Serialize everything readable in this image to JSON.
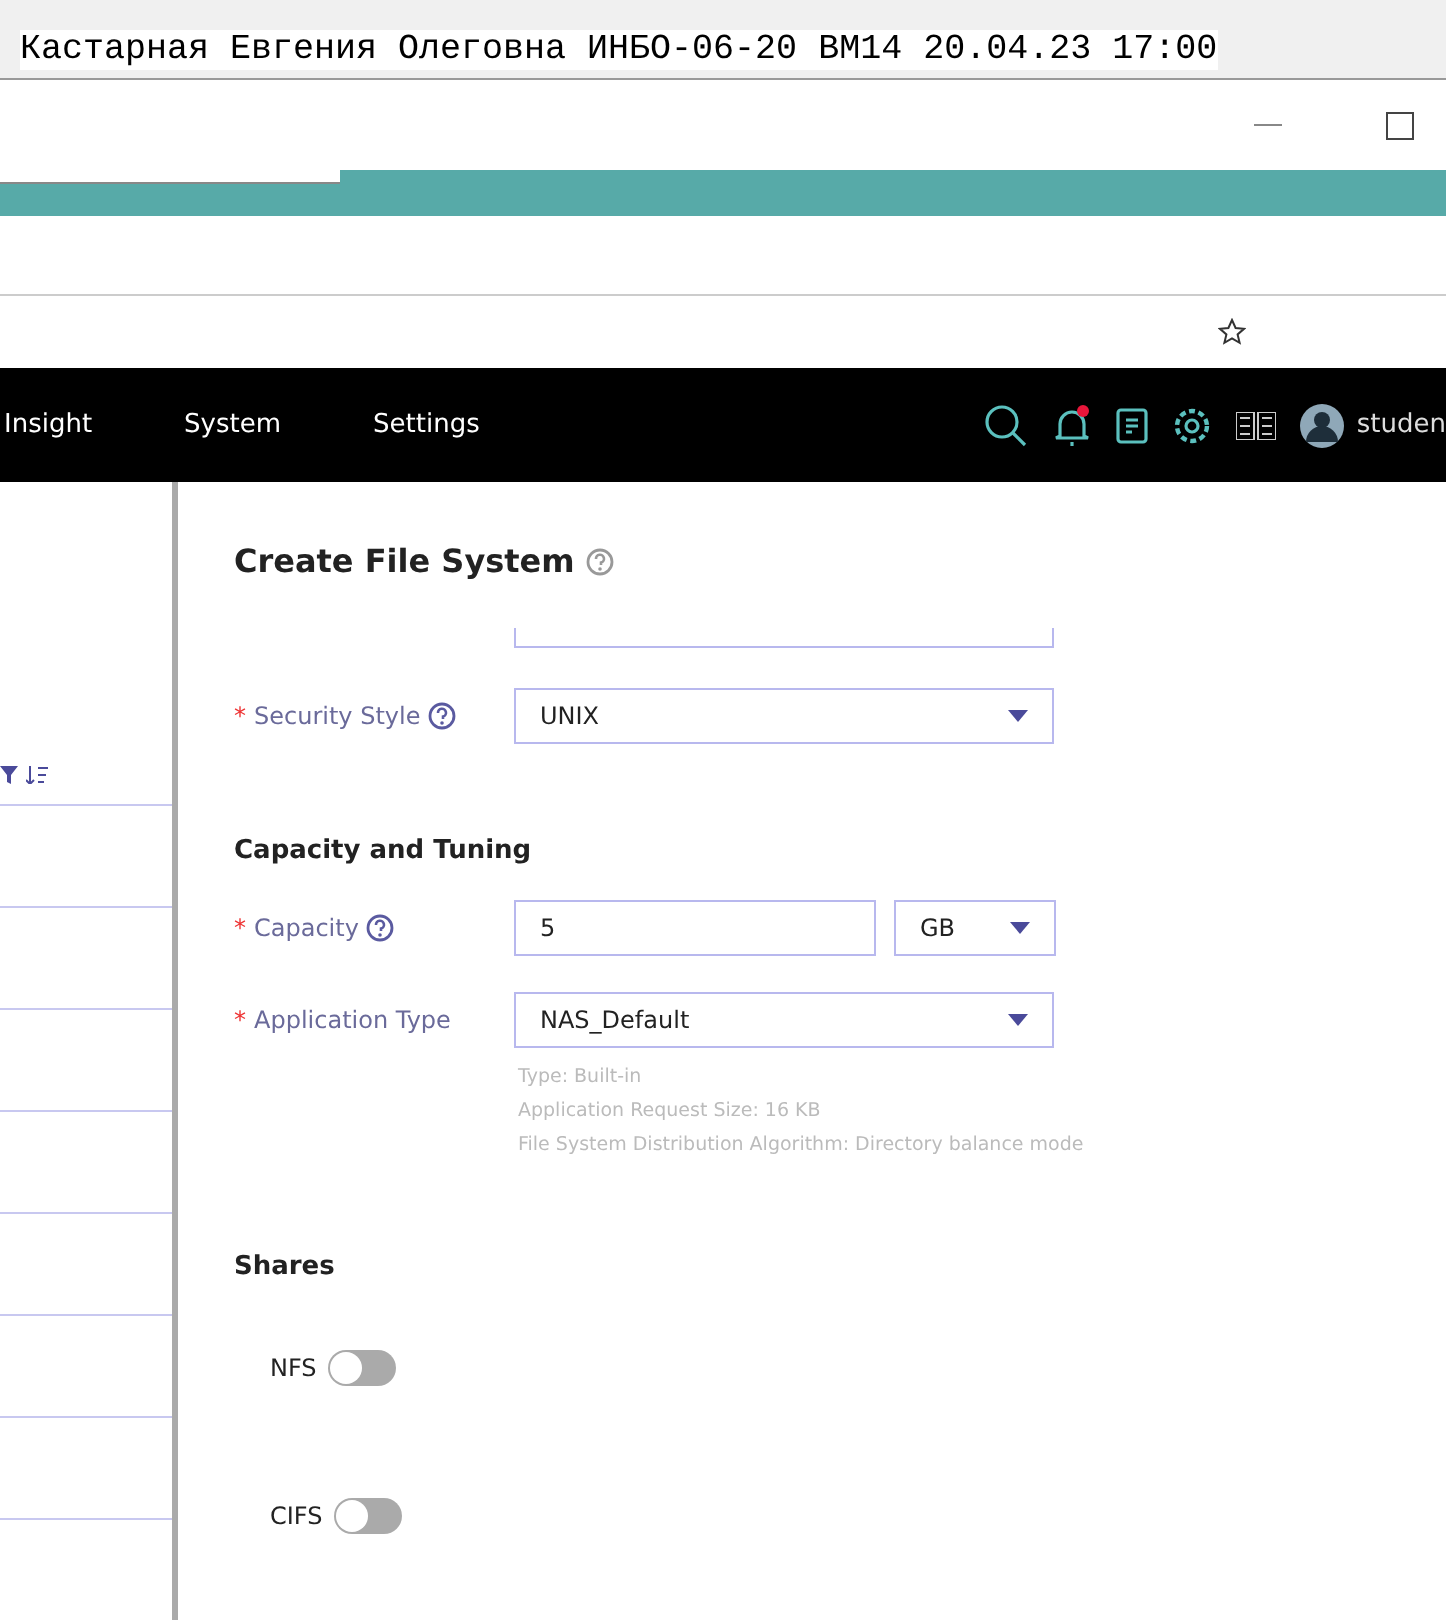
{
  "notepad": {
    "text": "Кастарная Евгения Олеговна ИНБО-06-20 ВМ14 20.04.23 17:00"
  },
  "nav": {
    "items": [
      {
        "label": "Insight"
      },
      {
        "label": "System"
      },
      {
        "label": "Settings"
      }
    ],
    "notification_badge": true,
    "user": "studen"
  },
  "dialog": {
    "title": "Create File System",
    "security_style": {
      "required_mark": "*",
      "label": "Security Style",
      "value": "UNIX"
    },
    "capacity_section": {
      "title": "Capacity and Tuning",
      "capacity": {
        "required_mark": "*",
        "label": "Capacity",
        "value": "5",
        "unit": "GB"
      },
      "application_type": {
        "required_mark": "*",
        "label": "Application Type",
        "value": "NAS_Default",
        "details": [
          "Type: Built-in",
          "Application Request Size: 16 KB",
          "File System Distribution Algorithm: Directory balance mode"
        ]
      }
    },
    "shares": {
      "title": "Shares",
      "toggles": [
        {
          "label": "NFS",
          "on": false
        },
        {
          "label": "CIFS",
          "on": false
        }
      ]
    }
  }
}
